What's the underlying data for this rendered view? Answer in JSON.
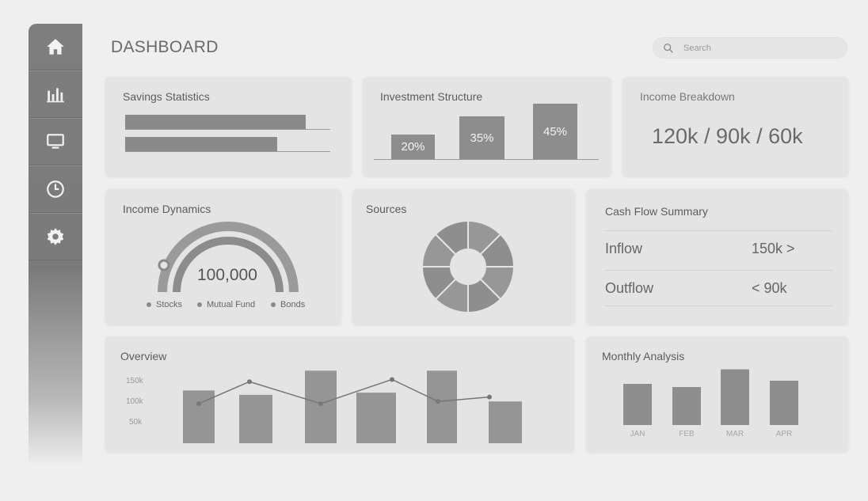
{
  "header": {
    "title": "DASHBOARD",
    "search_placeholder": "Search"
  },
  "sidebar": {
    "items": [
      {
        "icon": "home-icon"
      },
      {
        "icon": "bar-chart-icon"
      },
      {
        "icon": "monitor-icon"
      },
      {
        "icon": "clock-icon"
      },
      {
        "icon": "gear-icon"
      }
    ]
  },
  "savings": {
    "title": "Savings Statistics",
    "bars": [
      0.88,
      0.74
    ]
  },
  "investment": {
    "title": "Investment Structure",
    "bars": [
      {
        "label": "20%",
        "value": 20
      },
      {
        "label": "35%",
        "value": 35
      },
      {
        "label": "45%",
        "value": 45
      }
    ]
  },
  "income_breakdown": {
    "title": "Income Breakdown",
    "value": "120k / 90k / 60k"
  },
  "income_dynamics": {
    "title": "Income Dynamics",
    "value": "100,000",
    "legend": [
      "Stocks",
      "Mutual Fund",
      "Bonds"
    ]
  },
  "sources": {
    "title": "Sources",
    "segments": 8
  },
  "cash_flow": {
    "title": "Cash Flow Summary",
    "rows": [
      {
        "label": "Inflow",
        "value": "150k >"
      },
      {
        "label": "Outflow",
        "value": "< 90k"
      }
    ]
  },
  "overview": {
    "title": "Overview",
    "y_ticks": [
      "150k",
      "100k",
      "50k"
    ],
    "chart_data": {
      "type": "bar",
      "bars": [
        120,
        110,
        165,
        115,
        165,
        95
      ],
      "line": [
        90,
        140,
        90,
        145,
        95,
        105
      ],
      "ylim": [
        0,
        180
      ]
    }
  },
  "monthly": {
    "title": "Monthly Analysis",
    "chart_data": {
      "type": "bar",
      "categories": [
        "JAN",
        "FEB",
        "MAR",
        "APR"
      ],
      "values": [
        65,
        60,
        88,
        70
      ],
      "ylim": [
        0,
        100
      ]
    }
  }
}
